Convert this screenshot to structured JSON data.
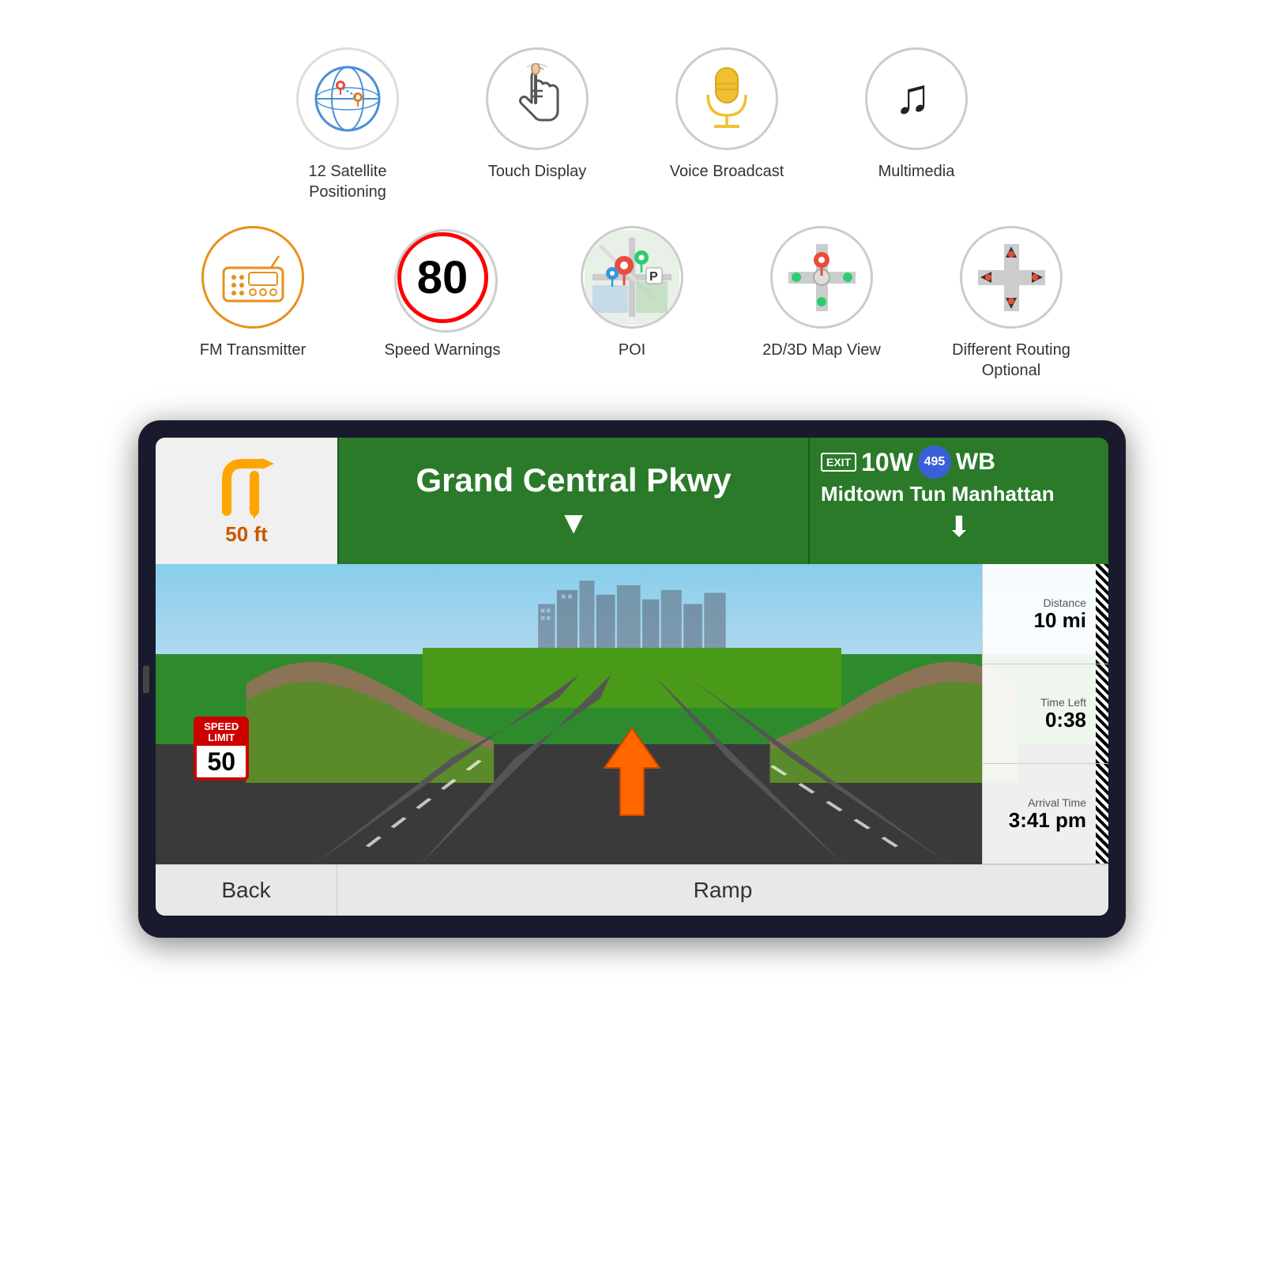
{
  "features": {
    "row1": [
      {
        "id": "satellite",
        "label": "12 Satellite Positioning",
        "icon_type": "satellite"
      },
      {
        "id": "touch",
        "label": "Touch Display",
        "icon_type": "touch"
      },
      {
        "id": "voice",
        "label": "Voice Broadcast",
        "icon_type": "voice"
      },
      {
        "id": "multimedia",
        "label": "Multimedia",
        "icon_type": "music"
      }
    ],
    "row2": [
      {
        "id": "fm",
        "label": "FM Transmitter",
        "icon_type": "fm"
      },
      {
        "id": "speed",
        "label": "Speed Warnings",
        "icon_type": "speed",
        "speed_number": "80"
      },
      {
        "id": "poi",
        "label": "POI",
        "icon_type": "poi"
      },
      {
        "id": "map2d3d",
        "label": "2D/3D Map View",
        "icon_type": "map2d3d"
      },
      {
        "id": "routing",
        "label": "Different Routing Optional",
        "icon_type": "routing"
      }
    ]
  },
  "navigation": {
    "turn_distance": "50 ft",
    "road_name": "Grand Central Pkwy",
    "exit_label": "EXIT",
    "exit_number": "10W",
    "highway_number": "495",
    "direction": "WB",
    "destination_line1": "Midtown Tun  Manhattan",
    "speed_limit_top": "SPEED LIMIT",
    "speed_limit_number": "50",
    "distance_label": "Distance",
    "distance_value": "10 mi",
    "time_left_label": "Time Left",
    "time_left_value": "0:38",
    "arrival_label": "Arrival Time",
    "arrival_value": "3:41 pm",
    "back_button": "Back",
    "ramp_button": "Ramp"
  }
}
